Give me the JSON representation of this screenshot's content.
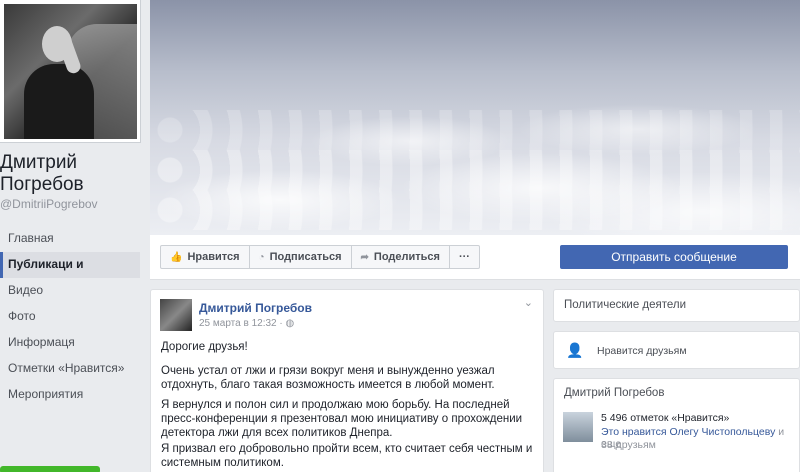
{
  "profile": {
    "name": "Дмитрий Погребов",
    "handle": "@DmitriiPogrebov"
  },
  "nav": {
    "items": [
      {
        "label": "Главная"
      },
      {
        "label": "Публикаци и"
      },
      {
        "label": "Видео"
      },
      {
        "label": "Фото"
      },
      {
        "label": "Информаця"
      },
      {
        "label": "Отметки «Нравится»"
      },
      {
        "label": "Мероприятия"
      }
    ]
  },
  "actions": {
    "like": "Нравится",
    "subscribe": "Подписаться",
    "share": "Поделиться",
    "more": "···",
    "message": "Отправить сообщение"
  },
  "post": {
    "author": "Дмитрий Погребов",
    "date": "25 марта в 12:32 · ",
    "globe_icon": "globe-icon",
    "menu_icon": "chevron-down-icon",
    "paragraphs": [
      "Дорогие друзья!",
      "Очень устал от лжи и грязи вокруг меня и вынужденно уезжал отдохнуть, благо такая возможность имеется в любой момент.",
      "Я вернулся и полон сил и продолжаю мою борьбу. На последней пресс-конференции я презентовал мою инициативу о прохождении детектора лжи для всех политиков Днепра.",
      "Я призвал его добровольно пройти всем, кто считает себя честным и системным политиком."
    ]
  },
  "right": {
    "category": "Политические деятели",
    "friends_like": "Нравится друзьям",
    "page_name": "Дмитрий Погребов",
    "likes_count": "5 496 отметок «Нравится»",
    "friends_text": "Это нравится Олегу Чистопольцеву",
    "friends_more": " и еще",
    "friends_count": "38 друзьям"
  },
  "colors": {
    "accent": "#4267b2",
    "link": "#365899",
    "background": "#e9ebee"
  }
}
